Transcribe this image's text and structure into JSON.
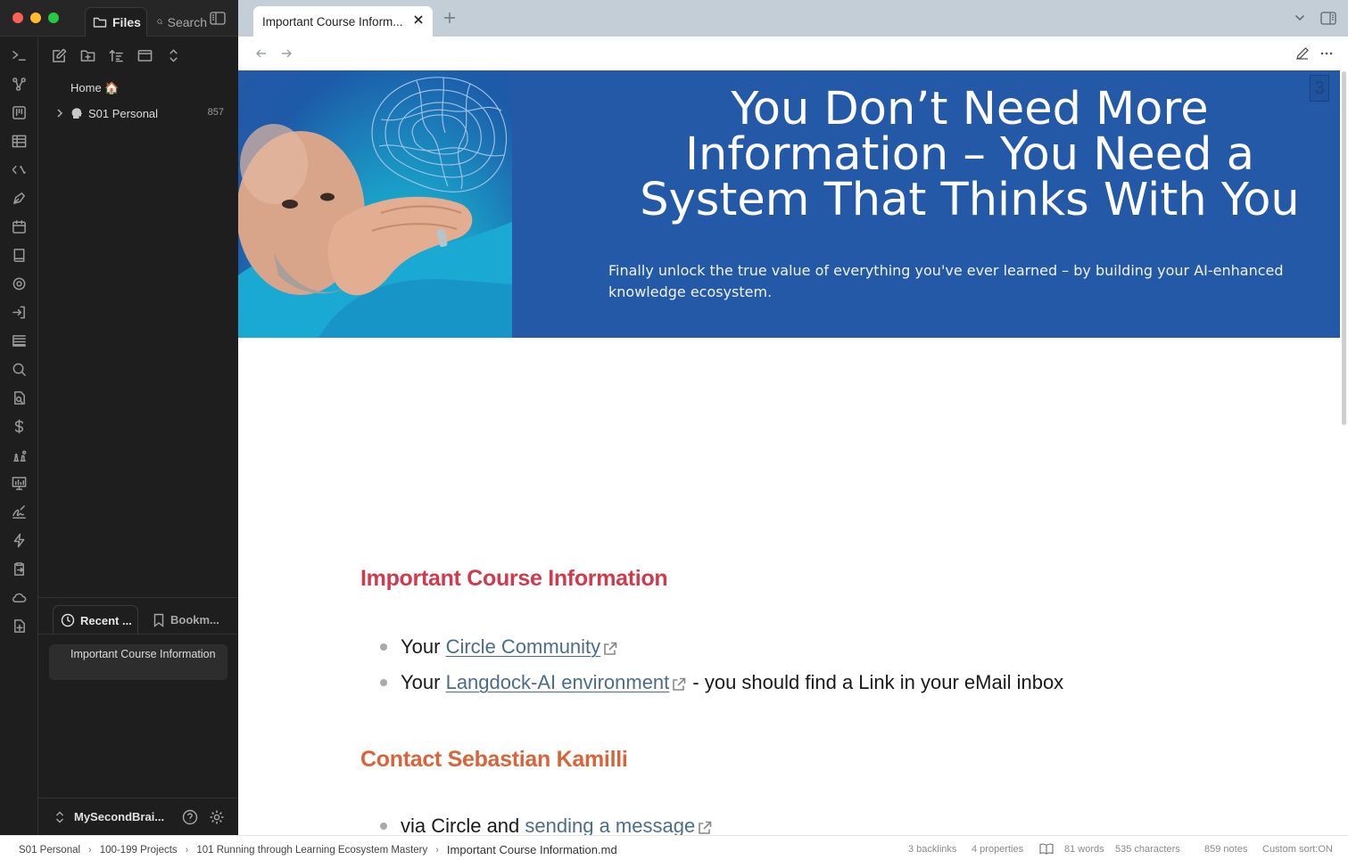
{
  "window": {
    "left_tabs": {
      "files": "Files",
      "search": "Search"
    },
    "note_tab": "Important Course Information",
    "note_tab_display": "Important Course Inform..."
  },
  "file_tree": {
    "home": "Home 🏠",
    "folder": "S01 Personal",
    "folder_count": "857"
  },
  "recent_pane": {
    "recent_tab": "Recent ...",
    "bookmarks_tab": "Bookm...",
    "items": [
      "Important Course Information"
    ]
  },
  "vault": {
    "name": "MySecondBrai..."
  },
  "hero": {
    "title": "You Don’t Need More Information – You Need a System That Thinks With You",
    "subtitle": "Finally unlock the true value of everything you've ever learned – by building your AI-enhanced knowledge ecosystem.",
    "badge": "3"
  },
  "content": {
    "heading_course": "Important Course Information",
    "bullet_1_prefix": "Your ",
    "bullet_1_link": "Circle Community",
    "bullet_2_prefix": "Your ",
    "bullet_2_link": "Langdock-AI environment",
    "bullet_2_suffix": " - you should find a Link in your eMail inbox",
    "heading_contact": "Contact Sebastian Kamilli",
    "bullet_3_prefix": "via Circle and ",
    "bullet_3_link": "sending a message"
  },
  "status": {
    "breadcrumbs": [
      "S01 Personal",
      "100-199 Projects",
      "101 Running through Learning Ecosystem Mastery"
    ],
    "file": "Important Course Information.md",
    "backlinks": "3 backlinks",
    "properties": "4 properties",
    "words": "81 words",
    "characters": "535 characters",
    "notes": "859 notes",
    "sort": "Custom sort:ON"
  },
  "colors": {
    "heading_course": "#d13a4c",
    "heading_contact": "#d8653a",
    "hero_bg": "#2459a7",
    "link": "#4a6e8a",
    "sidebar_bg": "#1e1e1e",
    "tabbar_bg": "#c3ced6"
  },
  "icons": {
    "ribbon": [
      "terminal-icon",
      "graph-icon",
      "kanban-icon",
      "table-icon",
      "percent-code-icon",
      "pen-nib-icon",
      "calendar-icon",
      "book-icon",
      "target-icon",
      "login-icon",
      "list-icon",
      "search-icon",
      "file-search-icon",
      "dollar-icon",
      "chess-icon",
      "presentation-icon",
      "signature-icon",
      "lightning-icon",
      "clipboard-export-icon",
      "cloud-icon",
      "file-plus-icon"
    ]
  }
}
